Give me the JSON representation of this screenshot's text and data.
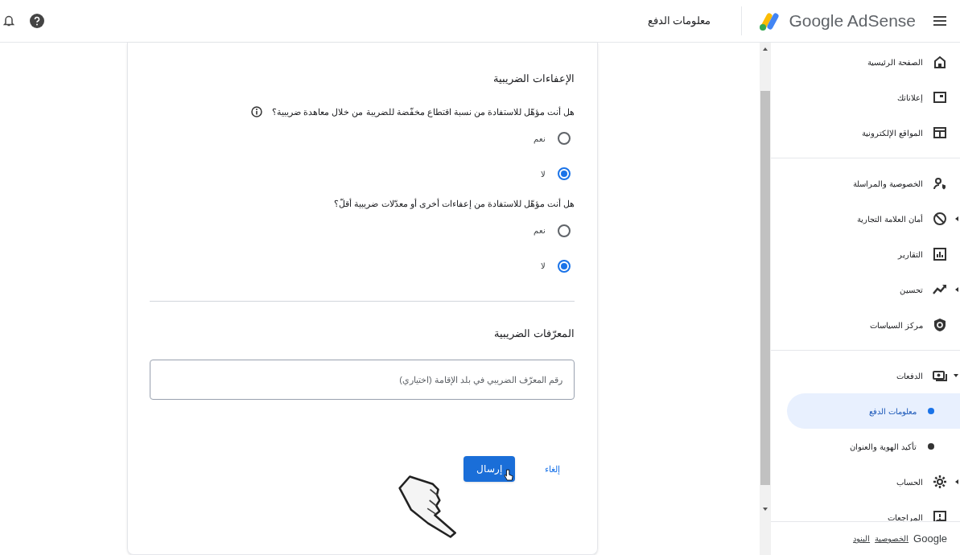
{
  "header": {
    "brand": "Google AdSense",
    "title": "معلومات الدفع"
  },
  "form": {
    "sections": [
      {
        "title": "الإعفاءات الضريبية",
        "questions": [
          {
            "text": "هل أنت مؤهّل للاستفادة من نسبة اقتطاع مخفّضة للضريبة من خلال معاهدة ضريبية؟",
            "info": true,
            "options": [
              {
                "label": "نعم",
                "selected": false
              },
              {
                "label": "لا",
                "selected": true
              }
            ]
          },
          {
            "text": "هل أنت مؤهّل للاستفادة من إعفاءات أخرى أو معدّلات ضريبية أقلّ؟",
            "info": false,
            "options": [
              {
                "label": "نعم",
                "selected": false
              },
              {
                "label": "لا",
                "selected": true
              }
            ]
          }
        ]
      },
      {
        "title": "المعرّفات الضريبية",
        "field": {
          "placeholder": "رقم المعرّف الضريبي في بلد الإقامة (اختياري)"
        }
      }
    ],
    "buttons": {
      "cancel": "إلغاء",
      "submit": "إرسال"
    }
  },
  "sidebar": {
    "groups": [
      [
        {
          "label": "الصفحة الرئيسية",
          "selected": false
        },
        {
          "label": "إعلاناتك",
          "selected": false
        },
        {
          "label": "المواقع الإلكترونية",
          "selected": false
        }
      ],
      [
        {
          "label": "الخصوصية والمراسلة",
          "selected": false
        },
        {
          "label": "أمان العلامة التجارية",
          "selected": false,
          "expanded": false
        },
        {
          "label": "التقارير",
          "selected": false
        },
        {
          "label": "تحسين",
          "selected": false,
          "expanded": false
        },
        {
          "label": "مركز السياسات",
          "selected": false
        }
      ],
      [
        {
          "label": "الدفعات",
          "selected": false,
          "expanded": true,
          "children": [
            {
              "label": "معلومات الدفع",
              "selected": true
            },
            {
              "label": "تأكيد الهوية والعنوان",
              "selected": false
            }
          ]
        },
        {
          "label": "الحساب",
          "selected": false,
          "expanded": false
        },
        {
          "label": "المراجعات",
          "selected": false
        }
      ]
    ],
    "footer": [
      "Google",
      "الخصوصية",
      "البنود"
    ]
  }
}
